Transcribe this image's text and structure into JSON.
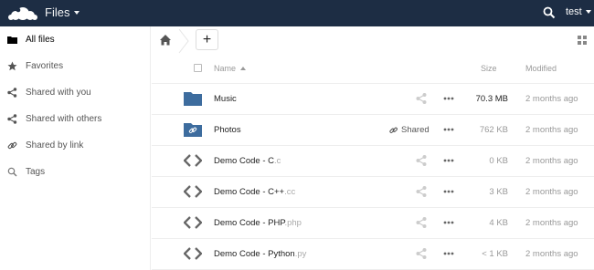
{
  "header": {
    "app_title": "Files",
    "user": "test",
    "bg_color": "#1d2d44"
  },
  "sidebar": {
    "items": [
      {
        "label": "All files",
        "icon": "folder-icon",
        "active": true
      },
      {
        "label": "Favorites",
        "icon": "star-icon"
      },
      {
        "label": "Shared with you",
        "icon": "share-icon"
      },
      {
        "label": "Shared with others",
        "icon": "share-icon"
      },
      {
        "label": "Shared by link",
        "icon": "link-icon"
      },
      {
        "label": "Tags",
        "icon": "tag-icon"
      }
    ]
  },
  "controls": {
    "new_label": "+"
  },
  "table": {
    "headers": {
      "name": "Name",
      "size": "Size",
      "modified": "Modified"
    },
    "rows": [
      {
        "name": "Music",
        "ext": "",
        "type": "folder",
        "size": "70.3 MB",
        "modified": "2 months ago",
        "shared": ""
      },
      {
        "name": "Photos",
        "ext": "",
        "type": "folder-link",
        "size": "762 KB",
        "modified": "2 months ago",
        "shared": "Shared"
      },
      {
        "name": "Demo Code - C",
        "ext": ".c",
        "type": "code",
        "size": "0 KB",
        "modified": "2 months ago",
        "shared": ""
      },
      {
        "name": "Demo Code - C++",
        "ext": ".cc",
        "type": "code",
        "size": "3 KB",
        "modified": "2 months ago",
        "shared": ""
      },
      {
        "name": "Demo Code - PHP",
        "ext": ".php",
        "type": "code",
        "size": "4 KB",
        "modified": "2 months ago",
        "shared": ""
      },
      {
        "name": "Demo Code - Python",
        "ext": ".py",
        "type": "code",
        "size": "< 1 KB",
        "modified": "2 months ago",
        "shared": ""
      }
    ]
  },
  "colors": {
    "folder": "#3d6c9e",
    "accent": "#1d2d44"
  }
}
